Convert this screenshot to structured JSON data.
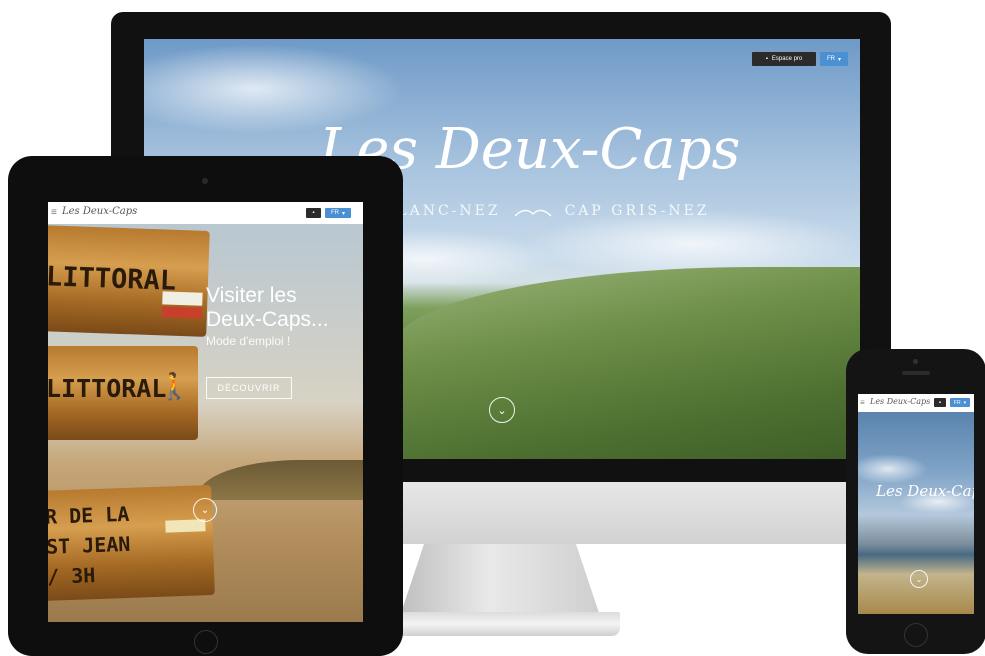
{
  "desktop": {
    "logo": "Les Deux-Caps",
    "subtitle_left": "BLANC-NEZ",
    "subtitle_right": "CAP GRIS-NEZ",
    "espace_pro_label": "Espace pro",
    "lang_label": "FR"
  },
  "tablet": {
    "logo": "Les Deux-Caps",
    "lang_label": "FR",
    "headline_line1": "Visiter les",
    "headline_line2": "Deux-Caps...",
    "tagline": "Mode d'emploi !",
    "cta_label": "DÉCOUVRIR",
    "sign1_text": "LITTORAL",
    "sign2_text": "LITTORAL",
    "sign3_line1": "R DE LA",
    "sign3_line2": "ST JEAN",
    "sign3_line3": "/ 3H"
  },
  "phone": {
    "logo": "Les Deux-Caps",
    "lang_label": "FR"
  }
}
